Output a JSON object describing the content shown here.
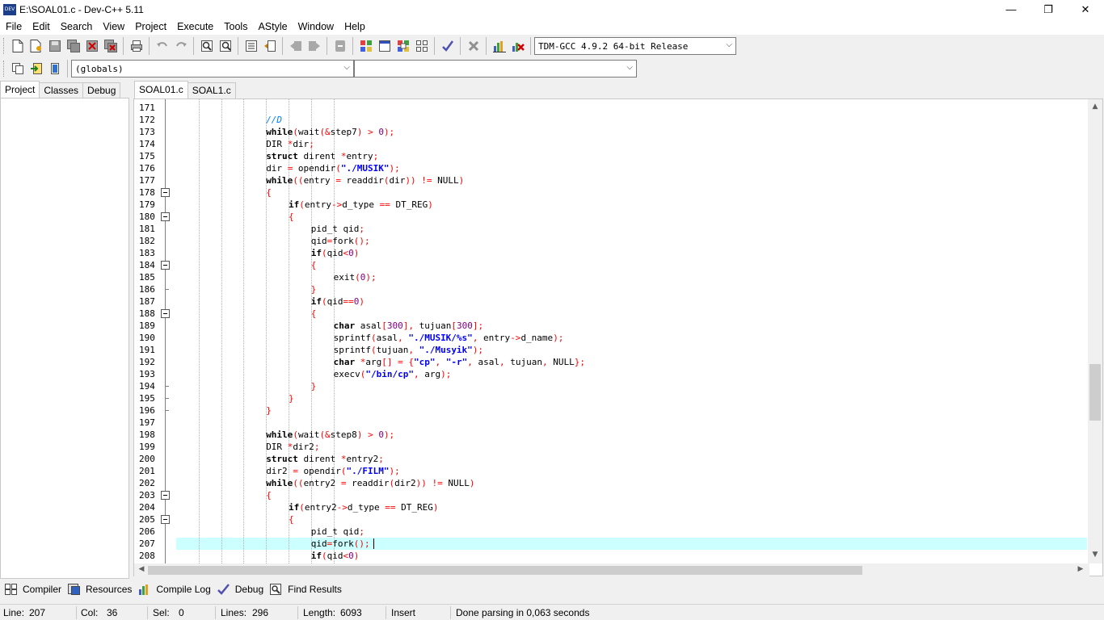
{
  "window": {
    "title": "E:\\SOAL01.c - Dev-C++ 5.11",
    "app_icon_text": "DEV",
    "minimize": "—",
    "maximize": "❐",
    "close": "✕"
  },
  "menu": [
    "File",
    "Edit",
    "Search",
    "View",
    "Project",
    "Execute",
    "Tools",
    "AStyle",
    "Window",
    "Help"
  ],
  "toolbar": {
    "compiler_select": "TDM-GCC 4.9.2 64-bit Release",
    "scope_select": "(globals)",
    "function_select": ""
  },
  "left_tabs": [
    "Project",
    "Classes",
    "Debug"
  ],
  "editor_tabs": [
    "SOAL01.c",
    "SOAL1.c"
  ],
  "editor": {
    "first_line": 171,
    "current_line": 207,
    "lines": [
      [],
      [
        [
          "cmt",
          "//D"
        ]
      ],
      [
        [
          "kw",
          "while"
        ],
        [
          "sy",
          "("
        ],
        [
          "pl",
          "wait"
        ],
        [
          "sy",
          "(&"
        ],
        [
          "pl",
          "step7"
        ],
        [
          "sy",
          ")"
        ],
        [
          "pl",
          " "
        ],
        [
          "sy",
          ">"
        ],
        [
          "pl",
          " "
        ],
        [
          "num",
          "0"
        ],
        [
          "sy",
          ");"
        ]
      ],
      [
        [
          "pl",
          "DIR "
        ],
        [
          "sy",
          "*"
        ],
        [
          "pl",
          "dir"
        ],
        [
          "sy",
          ";"
        ]
      ],
      [
        [
          "kw",
          "struct"
        ],
        [
          "pl",
          " dirent "
        ],
        [
          "sy",
          "*"
        ],
        [
          "pl",
          "entry"
        ],
        [
          "sy",
          ";"
        ]
      ],
      [
        [
          "pl",
          "dir "
        ],
        [
          "sy",
          "="
        ],
        [
          "pl",
          " opendir"
        ],
        [
          "sy",
          "("
        ],
        [
          "str",
          "\"./MUSIK\""
        ],
        [
          "sy",
          ");"
        ]
      ],
      [
        [
          "kw",
          "while"
        ],
        [
          "sy",
          "(("
        ],
        [
          "pl",
          "entry "
        ],
        [
          "sy",
          "="
        ],
        [
          "pl",
          " readdir"
        ],
        [
          "sy",
          "("
        ],
        [
          "pl",
          "dir"
        ],
        [
          "sy",
          "))"
        ],
        [
          "pl",
          " "
        ],
        [
          "sy",
          "!="
        ],
        [
          "pl",
          " NULL"
        ],
        [
          "sy",
          ")"
        ]
      ],
      [
        [
          "sy",
          "{"
        ]
      ],
      [
        [
          "kw",
          "if"
        ],
        [
          "sy",
          "("
        ],
        [
          "pl",
          "entry"
        ],
        [
          "sy",
          "->"
        ],
        [
          "pl",
          "d_type "
        ],
        [
          "sy",
          "=="
        ],
        [
          "pl",
          " DT_REG"
        ],
        [
          "sy",
          ")"
        ]
      ],
      [
        [
          "sy",
          "{"
        ]
      ],
      [
        [
          "pl",
          "pid_t qid"
        ],
        [
          "sy",
          ";"
        ]
      ],
      [
        [
          "pl",
          "qid"
        ],
        [
          "sy",
          "="
        ],
        [
          "pl",
          "fork"
        ],
        [
          "sy",
          "();"
        ]
      ],
      [
        [
          "kw",
          "if"
        ],
        [
          "sy",
          "("
        ],
        [
          "pl",
          "qid"
        ],
        [
          "sy",
          "<"
        ],
        [
          "num",
          "0"
        ],
        [
          "sy",
          ")"
        ]
      ],
      [
        [
          "sy",
          "{"
        ]
      ],
      [
        [
          "pl",
          "exit"
        ],
        [
          "sy",
          "("
        ],
        [
          "num",
          "0"
        ],
        [
          "sy",
          ");"
        ]
      ],
      [
        [
          "sy",
          "}"
        ]
      ],
      [
        [
          "kw",
          "if"
        ],
        [
          "sy",
          "("
        ],
        [
          "pl",
          "qid"
        ],
        [
          "sy",
          "=="
        ],
        [
          "num",
          "0"
        ],
        [
          "sy",
          ")"
        ]
      ],
      [
        [
          "sy",
          "{"
        ]
      ],
      [
        [
          "kw",
          "char"
        ],
        [
          "pl",
          " asal"
        ],
        [
          "sy",
          "["
        ],
        [
          "num",
          "300"
        ],
        [
          "sy",
          "],"
        ],
        [
          "pl",
          " tujuan"
        ],
        [
          "sy",
          "["
        ],
        [
          "num",
          "300"
        ],
        [
          "sy",
          "];"
        ]
      ],
      [
        [
          "pl",
          "sprintf"
        ],
        [
          "sy",
          "("
        ],
        [
          "pl",
          "asal"
        ],
        [
          "sy",
          ","
        ],
        [
          "pl",
          " "
        ],
        [
          "str",
          "\"./MUSIK/%s\""
        ],
        [
          "sy",
          ","
        ],
        [
          "pl",
          " entry"
        ],
        [
          "sy",
          "->"
        ],
        [
          "pl",
          "d_name"
        ],
        [
          "sy",
          ");"
        ]
      ],
      [
        [
          "pl",
          "sprintf"
        ],
        [
          "sy",
          "("
        ],
        [
          "pl",
          "tujuan"
        ],
        [
          "sy",
          ","
        ],
        [
          "pl",
          " "
        ],
        [
          "str",
          "\"./Musyik\""
        ],
        [
          "sy",
          ");"
        ]
      ],
      [
        [
          "kw",
          "char"
        ],
        [
          "pl",
          " "
        ],
        [
          "sy",
          "*"
        ],
        [
          "pl",
          "arg"
        ],
        [
          "sy",
          "[]"
        ],
        [
          "pl",
          " "
        ],
        [
          "sy",
          "="
        ],
        [
          "pl",
          " "
        ],
        [
          "sy",
          "{"
        ],
        [
          "str",
          "\"cp\""
        ],
        [
          "sy",
          ","
        ],
        [
          "pl",
          " "
        ],
        [
          "str",
          "\"-r\""
        ],
        [
          "sy",
          ","
        ],
        [
          "pl",
          " asal"
        ],
        [
          "sy",
          ","
        ],
        [
          "pl",
          " tujuan"
        ],
        [
          "sy",
          ","
        ],
        [
          "pl",
          " NULL"
        ],
        [
          "sy",
          "};"
        ]
      ],
      [
        [
          "pl",
          "execv"
        ],
        [
          "sy",
          "("
        ],
        [
          "str",
          "\"/bin/cp\""
        ],
        [
          "sy",
          ","
        ],
        [
          "pl",
          " arg"
        ],
        [
          "sy",
          ");"
        ]
      ],
      [
        [
          "sy",
          "}"
        ]
      ],
      [
        [
          "sy",
          "}"
        ]
      ],
      [
        [
          "sy",
          "}"
        ]
      ],
      [],
      [
        [
          "kw",
          "while"
        ],
        [
          "sy",
          "("
        ],
        [
          "pl",
          "wait"
        ],
        [
          "sy",
          "(&"
        ],
        [
          "pl",
          "step8"
        ],
        [
          "sy",
          ")"
        ],
        [
          "pl",
          " "
        ],
        [
          "sy",
          ">"
        ],
        [
          "pl",
          " "
        ],
        [
          "num",
          "0"
        ],
        [
          "sy",
          ");"
        ]
      ],
      [
        [
          "pl",
          "DIR "
        ],
        [
          "sy",
          "*"
        ],
        [
          "pl",
          "dir2"
        ],
        [
          "sy",
          ";"
        ]
      ],
      [
        [
          "kw",
          "struct"
        ],
        [
          "pl",
          " dirent "
        ],
        [
          "sy",
          "*"
        ],
        [
          "pl",
          "entry2"
        ],
        [
          "sy",
          ";"
        ]
      ],
      [
        [
          "pl",
          "dir2 "
        ],
        [
          "sy",
          "="
        ],
        [
          "pl",
          " opendir"
        ],
        [
          "sy",
          "("
        ],
        [
          "str",
          "\"./FILM\""
        ],
        [
          "sy",
          ");"
        ]
      ],
      [
        [
          "kw",
          "while"
        ],
        [
          "sy",
          "(("
        ],
        [
          "pl",
          "entry2 "
        ],
        [
          "sy",
          "="
        ],
        [
          "pl",
          " readdir"
        ],
        [
          "sy",
          "("
        ],
        [
          "pl",
          "dir2"
        ],
        [
          "sy",
          "))"
        ],
        [
          "pl",
          " "
        ],
        [
          "sy",
          "!="
        ],
        [
          "pl",
          " NULL"
        ],
        [
          "sy",
          ")"
        ]
      ],
      [
        [
          "sy",
          "{"
        ]
      ],
      [
        [
          "kw",
          "if"
        ],
        [
          "sy",
          "("
        ],
        [
          "pl",
          "entry2"
        ],
        [
          "sy",
          "->"
        ],
        [
          "pl",
          "d_type "
        ],
        [
          "sy",
          "=="
        ],
        [
          "pl",
          " DT_REG"
        ],
        [
          "sy",
          ")"
        ]
      ],
      [
        [
          "sy",
          "{"
        ]
      ],
      [
        [
          "pl",
          "pid_t qid"
        ],
        [
          "sy",
          ";"
        ]
      ],
      [
        [
          "pl",
          "qid"
        ],
        [
          "sy",
          "="
        ],
        [
          "pl",
          "fork"
        ],
        [
          "sy",
          "();"
        ]
      ],
      [
        [
          "kw",
          "if"
        ],
        [
          "sy",
          "("
        ],
        [
          "pl",
          "qid"
        ],
        [
          "sy",
          "<"
        ],
        [
          "num",
          "0"
        ],
        [
          "sy",
          ")"
        ]
      ]
    ]
  },
  "bottom_tabs": [
    "Compiler",
    "Resources",
    "Compile Log",
    "Debug",
    "Find Results"
  ],
  "status": {
    "line_label": "Line:",
    "line_value": "207",
    "col_label": "Col:",
    "col_value": "36",
    "sel_label": "Sel:",
    "sel_value": "0",
    "lines_label": "Lines:",
    "lines_value": "296",
    "length_label": "Length:",
    "length_value": "6093",
    "mode": "Insert",
    "message": "Done parsing in 0,063 seconds"
  }
}
